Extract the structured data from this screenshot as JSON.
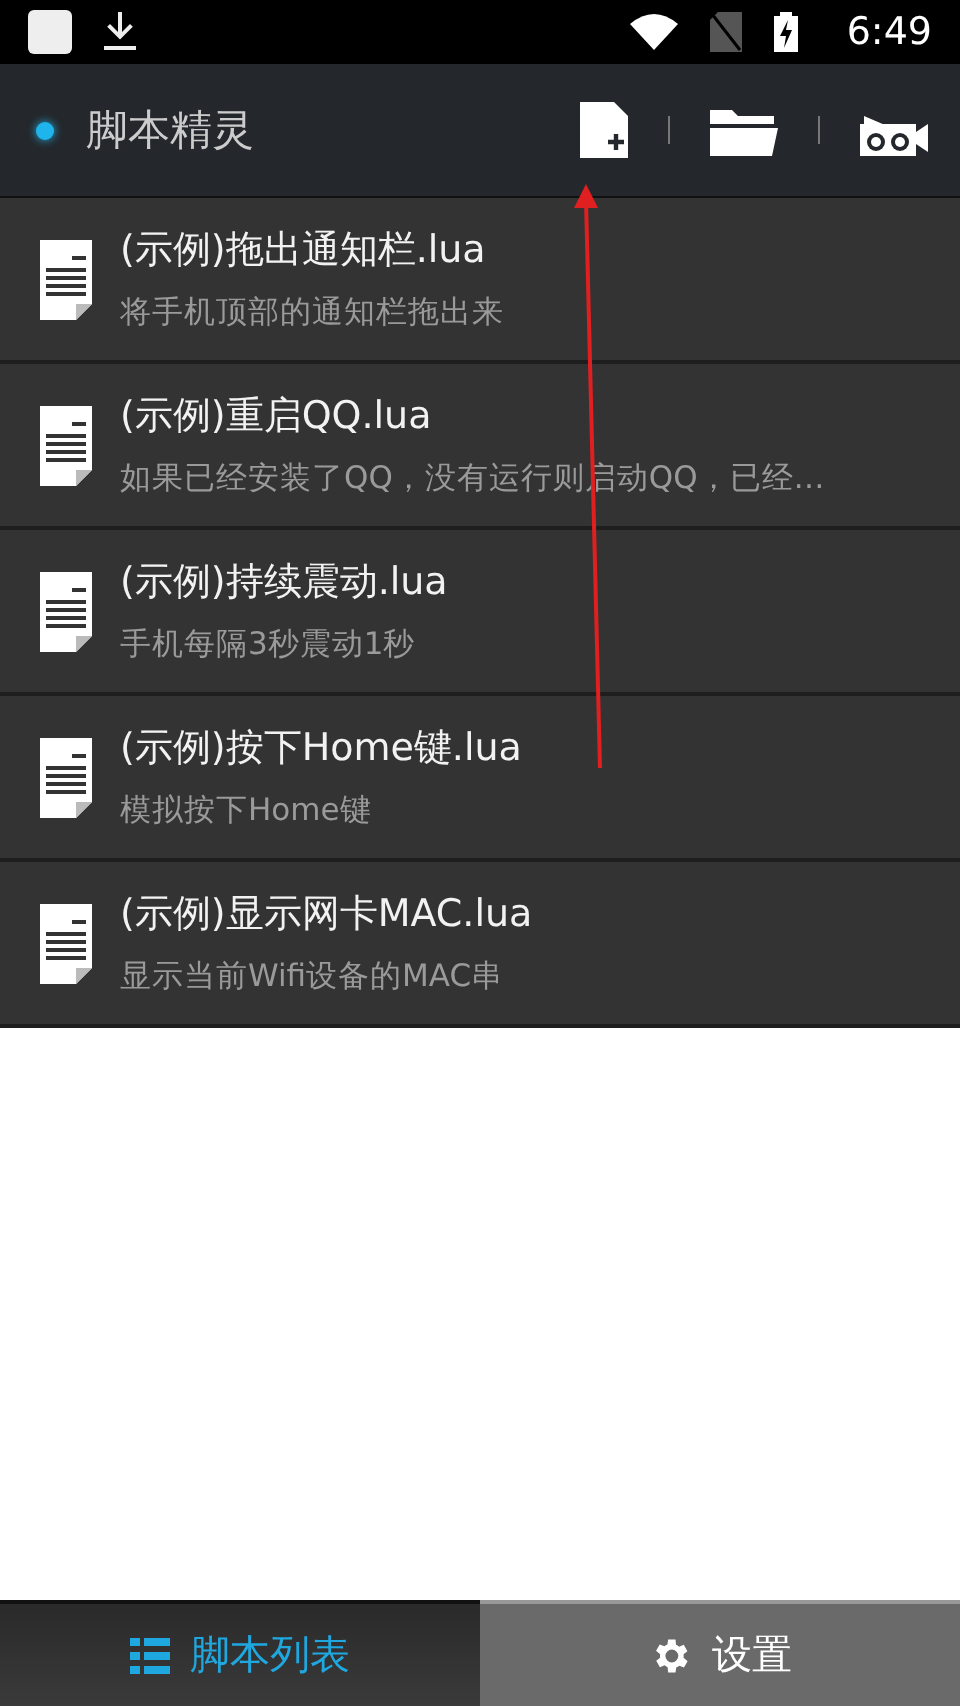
{
  "status_bar": {
    "time": "6:49"
  },
  "app_bar": {
    "title": "脚本精灵"
  },
  "scripts": [
    {
      "name": "(示例)拖出通知栏.lua",
      "description": "将手机顶部的通知栏拖出来"
    },
    {
      "name": "(示例)重启QQ.lua",
      "description": "如果已经安装了QQ，没有运行则启动QQ，已经…"
    },
    {
      "name": "(示例)持续震动.lua",
      "description": "手机每隔3秒震动1秒"
    },
    {
      "name": "(示例)按下Home键.lua",
      "description": "模拟按下Home键"
    },
    {
      "name": "(示例)显示网卡MAC.lua",
      "description": "显示当前Wifi设备的MAC串"
    }
  ],
  "bottom_tabs": [
    {
      "label": "脚本列表",
      "kind": "list",
      "selected": true
    },
    {
      "label": "设置",
      "kind": "settings",
      "selected": false
    }
  ]
}
